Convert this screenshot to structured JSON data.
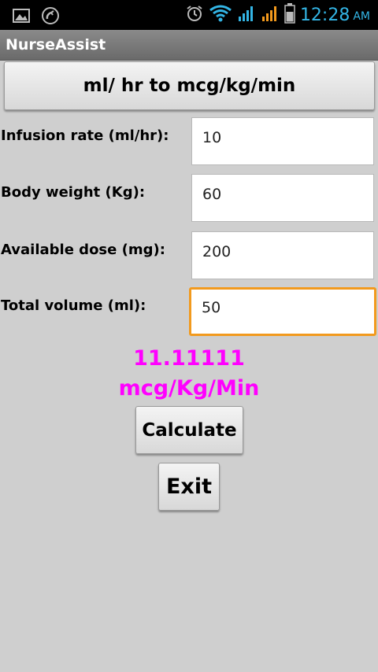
{
  "status_bar": {
    "time": "12:28",
    "ampm": "AM",
    "icons": [
      "gallery-icon",
      "missed-call-icon",
      "alarm-icon",
      "wifi-icon",
      "signal-1-icon",
      "signal-2-icon",
      "battery-icon"
    ]
  },
  "app": {
    "title": "NurseAssist"
  },
  "conversion_button": {
    "label": "ml/ hr to mcg/kg/min"
  },
  "form": {
    "infusion_rate": {
      "label": "Infusion rate  (ml/hr):",
      "value": "10"
    },
    "body_weight": {
      "label": "Body weight (Kg):",
      "value": "60"
    },
    "available_dose": {
      "label": "Available dose (mg):",
      "value": "200"
    },
    "total_volume": {
      "label": "Total volume (ml):",
      "value": "50"
    }
  },
  "result": {
    "value": "11.11111",
    "unit": "mcg/Kg/Min",
    "color": "#ff00ff"
  },
  "calculate_button": {
    "label": "Calculate"
  },
  "exit_button": {
    "label": "Exit"
  },
  "colors": {
    "accent_time": "#33b5e5",
    "focus_border": "#f29a1e"
  }
}
